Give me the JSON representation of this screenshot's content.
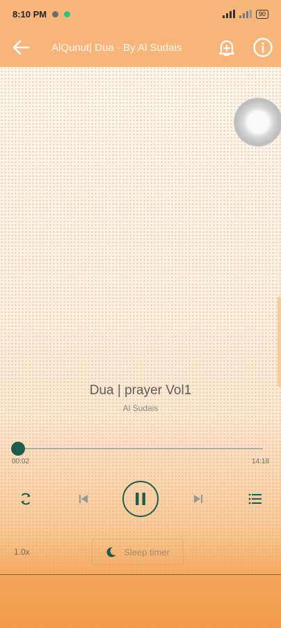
{
  "status_bar": {
    "time": "8:10 PM",
    "battery": "90"
  },
  "toolbar": {
    "title": "AlQunut| Dua - By Al Sudais"
  },
  "track": {
    "title": "Dua | prayer Vol1",
    "artist": "Al Sudais"
  },
  "progress": {
    "current": "00:02",
    "duration": "14:18",
    "fraction": 0.002
  },
  "controls": {
    "playback_speed": "1.0x",
    "sleep_timer_label": "Sleep timer"
  },
  "colors": {
    "accent": "#1f5c4e",
    "toolbar": "#f8b57a",
    "bottom_gradient": "#f39a45"
  },
  "icons": [
    "back-arrow-icon",
    "add-alarm-icon",
    "info-icon",
    "repeat-icon",
    "skip-previous-icon",
    "pause-icon",
    "skip-next-icon",
    "playlist-icon",
    "moon-icon"
  ]
}
